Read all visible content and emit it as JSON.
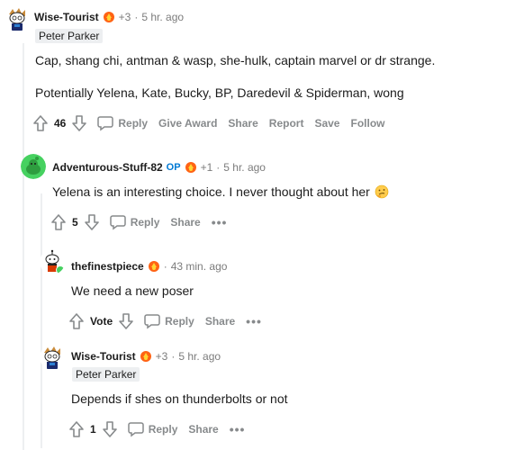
{
  "comments": [
    {
      "author": "Wise-Tourist",
      "award_count": "+3",
      "time": "5 hr. ago",
      "flair": "Peter Parker",
      "op": "",
      "paragraphs": [
        "Cap, shang chi, antman & wasp, she-hulk, captain marvel or dr strange.",
        "Potentially Yelena, Kate, Bucky, BP, Daredevil & Spiderman, wong"
      ],
      "score": "46",
      "actions": [
        "Reply",
        "Give Award",
        "Share",
        "Report",
        "Save",
        "Follow"
      ]
    },
    {
      "author": "Adventurous-Stuff-82",
      "op": "OP",
      "award_count": "+1",
      "time": "5 hr. ago",
      "text": "Yelena is an interesting choice. I never thought about her",
      "score": "5",
      "actions": [
        "Reply",
        "Share"
      ]
    },
    {
      "author": "thefinestpiece",
      "time": "43 min. ago",
      "text": "We need a new poser",
      "score": "Vote",
      "actions": [
        "Reply",
        "Share"
      ]
    },
    {
      "author": "Wise-Tourist",
      "award_count": "+3",
      "time": "5 hr. ago",
      "flair": "Peter Parker",
      "text": "Depends if shes on thunderbolts or not",
      "score": "1",
      "actions": [
        "Reply",
        "Share"
      ]
    }
  ],
  "separator": "·",
  "more": "•••",
  "colors": {
    "op": "#0079d3",
    "action": "#878a8c",
    "thread": "#edeff1"
  },
  "icons": [
    "upvote-icon",
    "downvote-icon",
    "reply-icon",
    "more-icon",
    "award-icon",
    "emoji-icon"
  ]
}
